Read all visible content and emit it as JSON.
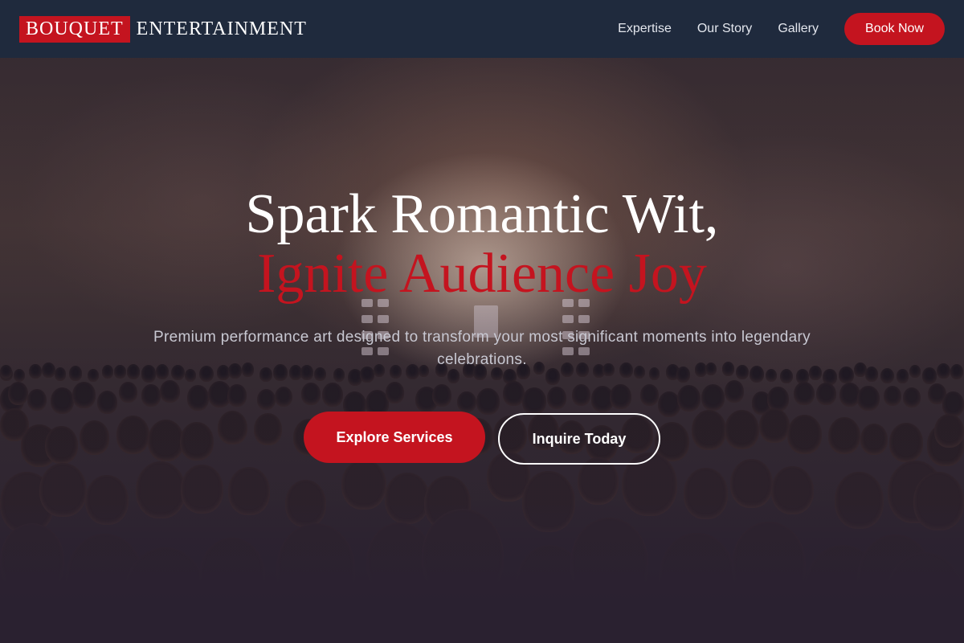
{
  "brand": {
    "highlight": "BOUQUET",
    "rest": "ENTERTAINMENT"
  },
  "nav": {
    "links": [
      "Expertise",
      "Our Story",
      "Gallery"
    ],
    "cta": "Book Now"
  },
  "hero": {
    "headline_line1": "Spark Romantic Wit,",
    "headline_line2": "Ignite Audience Joy",
    "subtitle": "Premium performance art designed to transform your most significant moments into legendary celebrations.",
    "primary_cta": "Explore Services",
    "secondary_cta": "Inquire Today",
    "background_image": "concert-crowd-photo"
  },
  "colors": {
    "accent": "#c4141f",
    "nav_background": "#1f2a3d",
    "text_light": "#ffffff",
    "subtitle_text": "#c8c8d2"
  }
}
